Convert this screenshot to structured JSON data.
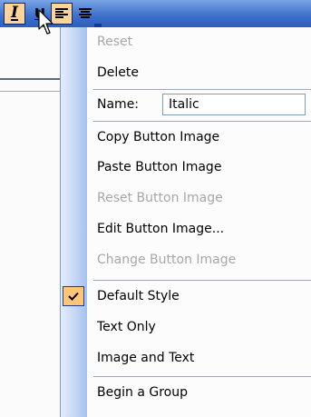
{
  "toolbar": {
    "italic_icon": "italic-icon",
    "underline_label": "U",
    "align_left_icon": "align-left-icon",
    "align_center_icon": "align-center-icon"
  },
  "menu": {
    "reset": "Reset",
    "delete": "Delete",
    "name_label": "Name:",
    "name_value": "Italic",
    "copy_button_image": "Copy Button Image",
    "paste_button_image": "Paste Button Image",
    "reset_button_image": "Reset Button Image",
    "edit_button_image": "Edit Button Image...",
    "change_button_image": "Change Button Image",
    "default_style": "Default Style",
    "text_only": "Text Only",
    "image_and_text": "Image and Text",
    "begin_a_group": "Begin a Group"
  },
  "colors": {
    "toolbar_blue": "#3d6fcb",
    "highlight_orange": "#ffc57a",
    "disabled_text": "#a7a7a7"
  }
}
